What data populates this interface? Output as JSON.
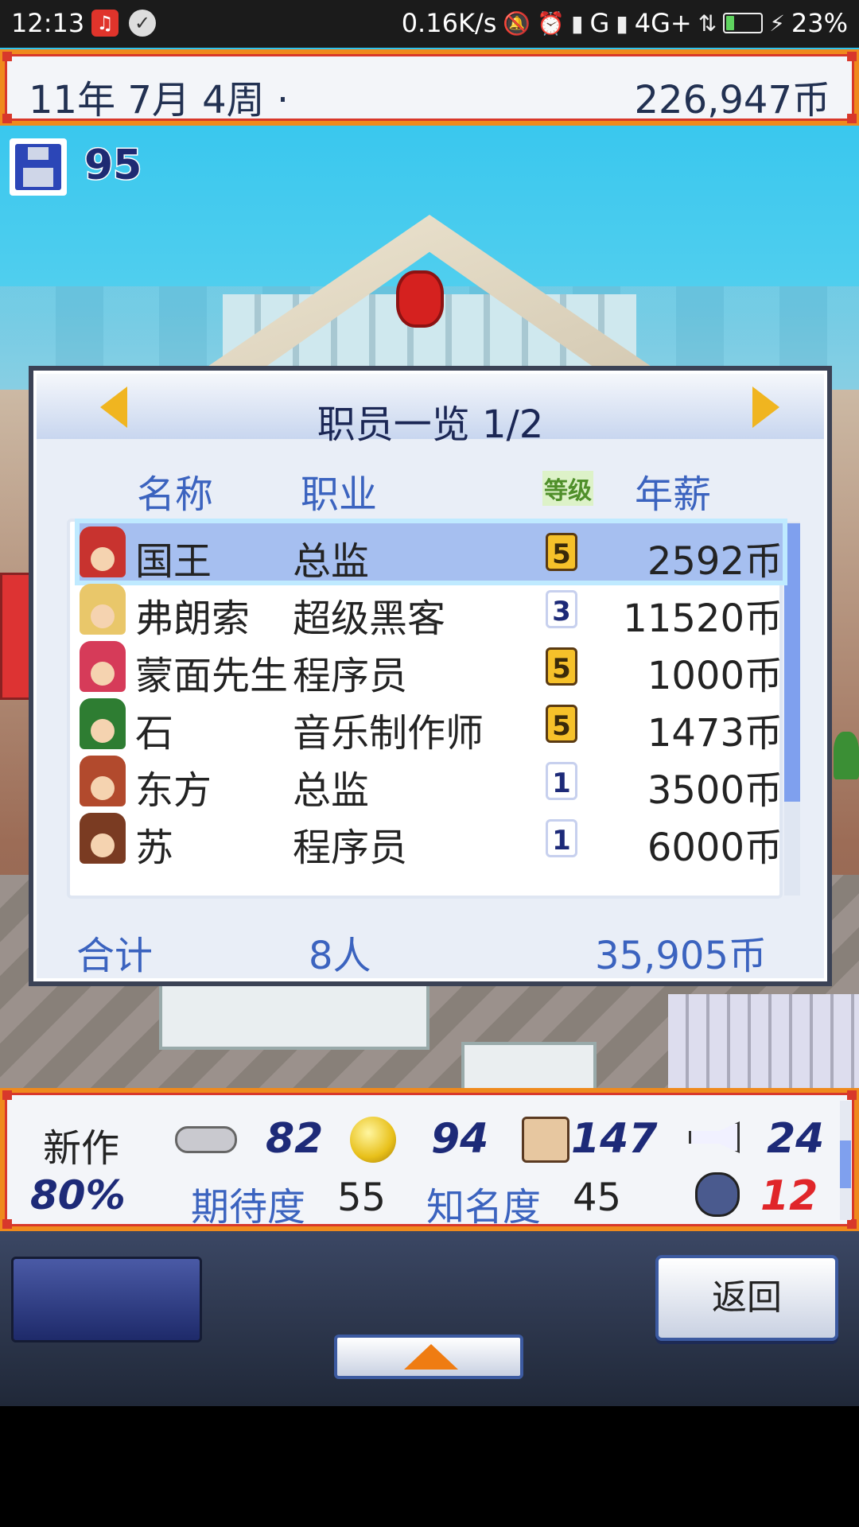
{
  "status_bar": {
    "time": "12:13",
    "net_speed": "0.16K/s",
    "signal": "G",
    "network": "4G+",
    "battery": "23%",
    "battery_level": 0.23
  },
  "header": {
    "date": "11年 7月 4周 ·",
    "money": "226,947币"
  },
  "save": {
    "icon": "floppy-disk-icon",
    "count": "95"
  },
  "staff_dialog": {
    "title": "职员一览 1/2",
    "columns": {
      "name": "名称",
      "job": "职业",
      "level": "等级",
      "salary": "年薪"
    },
    "rows": [
      {
        "name": "国王",
        "job": "总监",
        "level": "5",
        "salary": "2592币",
        "avatar_color": "#c8332f"
      },
      {
        "name": "弗朗索",
        "job": "超级黑客",
        "level": "3",
        "salary": "11520币",
        "avatar_color": "#e9c76a"
      },
      {
        "name": "蒙面先生",
        "job": "程序员",
        "level": "5",
        "salary": "1000币",
        "avatar_color": "#d63b59"
      },
      {
        "name": "石",
        "job": "音乐制作师",
        "level": "5",
        "salary": "1473币",
        "avatar_color": "#2e7d32"
      },
      {
        "name": "东方",
        "job": "总监",
        "level": "1",
        "salary": "3500币",
        "avatar_color": "#b24a2d"
      },
      {
        "name": "苏",
        "job": "程序员",
        "level": "1",
        "salary": "6000币",
        "avatar_color": "#7a3b22"
      }
    ],
    "total_label": "合计",
    "total_count": "8人",
    "total_salary": "35,905币"
  },
  "stats": {
    "new_label": "新作",
    "progress": "80%",
    "fun": "82",
    "creativity": "94",
    "graphics": "147",
    "sound": "24",
    "expectation_label": "期待度",
    "expectation": "55",
    "fame_label": "知名度",
    "fame": "45",
    "bugs": "12"
  },
  "controls": {
    "back_label": "返回"
  },
  "colors": {
    "frame_orange": "#ef8a1d",
    "frame_red": "#d8382b",
    "header_text": "#3b63bf",
    "dark_blue": "#1d2a78"
  }
}
